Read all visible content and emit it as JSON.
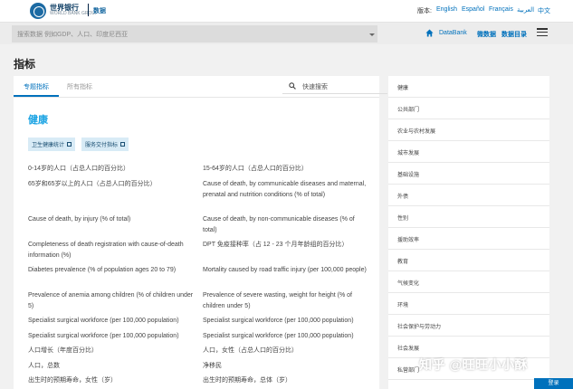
{
  "header": {
    "brand_cn": "世界银行",
    "brand_sub": "WORLD BANK GROUP",
    "brand_section": "数据",
    "lang_label": "版本:",
    "languages": [
      "English",
      "Español",
      "Français",
      "العربية",
      "中文"
    ]
  },
  "search": {
    "placeholder": "搜索数据 例如GDP、人口、印度尼西亚"
  },
  "nav": {
    "databank": "DataBank",
    "micro": "微数据",
    "catalog": "数据目录"
  },
  "page": {
    "title": "指标"
  },
  "tabs": {
    "topic": "专题指标",
    "all": "所有指标",
    "quick_search": "快速搜索"
  },
  "section": {
    "title": "健康",
    "pills": [
      "卫生健康统计",
      "服务交付指标"
    ]
  },
  "indicators": [
    "0-14岁的人口（占总人口的百分比）",
    "15-64岁的人口（占总人口的百分比）",
    "65岁和65岁以上的人口（占总人口的百分比）",
    "Cause of death, by communicable diseases and maternal, prenatal and nutrition conditions (% of total)",
    "Cause of death, by injury (% of total)",
    "Cause of death, by non-communicable diseases (% of total)",
    "Completeness of death registration with cause-of-death information (%)",
    "DPT 免疫接种率（占 12 - 23 个月年龄组的百分比）",
    "Diabetes prevalence (% of population ages 20 to 79)",
    "Mortality caused by road traffic injury (per 100,000 people)",
    "Prevalence of anemia among children (% of children under 5)",
    "Prevalence of severe wasting, weight for height (% of children under 5)",
    "Specialist surgical workforce (per 100,000 population)",
    "Specialist surgical workforce (per 100,000 population)",
    "Specialist surgical workforce (per 100,000 population)",
    "Specialist surgical workforce (per 100,000 population)",
    "人口增长（年度百分比）",
    "人口，女性（占总人口的百分比）",
    "人口，总数",
    "净移民",
    "出生时的预期寿命，女性（岁）",
    "出生时的预期寿命，总体（岁）"
  ],
  "sidebar": {
    "items": [
      "健康",
      "公共部门",
      "农业与农村发展",
      "城市发展",
      "基础设施",
      "外债",
      "性别",
      "援助效率",
      "教育",
      "气候变化",
      "环境",
      "社会保护与劳动力",
      "社会发展",
      "私营部门"
    ]
  },
  "watermark": "知乎 @旺旺小小酥",
  "corner_badge": "登录",
  "colors": {
    "accent": "#0071bc",
    "section_title": "#1aa3e3",
    "pill_bg": "#d8ebf6"
  }
}
